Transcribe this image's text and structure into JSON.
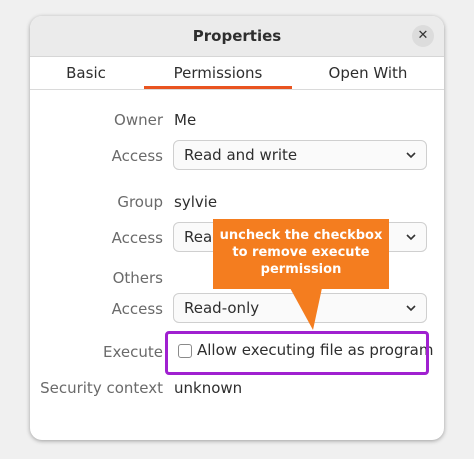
{
  "dialog": {
    "title": "Properties",
    "close_icon": "close-icon",
    "tabs": [
      {
        "label": "Basic",
        "active": false
      },
      {
        "label": "Permissions",
        "active": true
      },
      {
        "label": "Open With",
        "active": false
      }
    ],
    "accent_color": "#e95420"
  },
  "permissions": {
    "owner_label": "Owner",
    "owner_value": "Me",
    "owner_access_label": "Access",
    "owner_access_value": "Read and write",
    "group_label": "Group",
    "group_value": "sylvie",
    "group_access_label": "Access",
    "group_access_value": "Read-only",
    "others_label": "Others",
    "others_access_label": "Access",
    "others_access_value": "Read-only",
    "execute_label": "Execute",
    "execute_checkbox_label": "Allow executing file as program",
    "execute_checked": false,
    "security_context_label": "Security context",
    "security_context_value": "unknown"
  },
  "annotation": {
    "callout_lines": [
      "uncheck the checkbox",
      "to remove execute",
      "permission"
    ],
    "callout_color": "#f47d1f",
    "highlight_color": "#a020d0"
  }
}
